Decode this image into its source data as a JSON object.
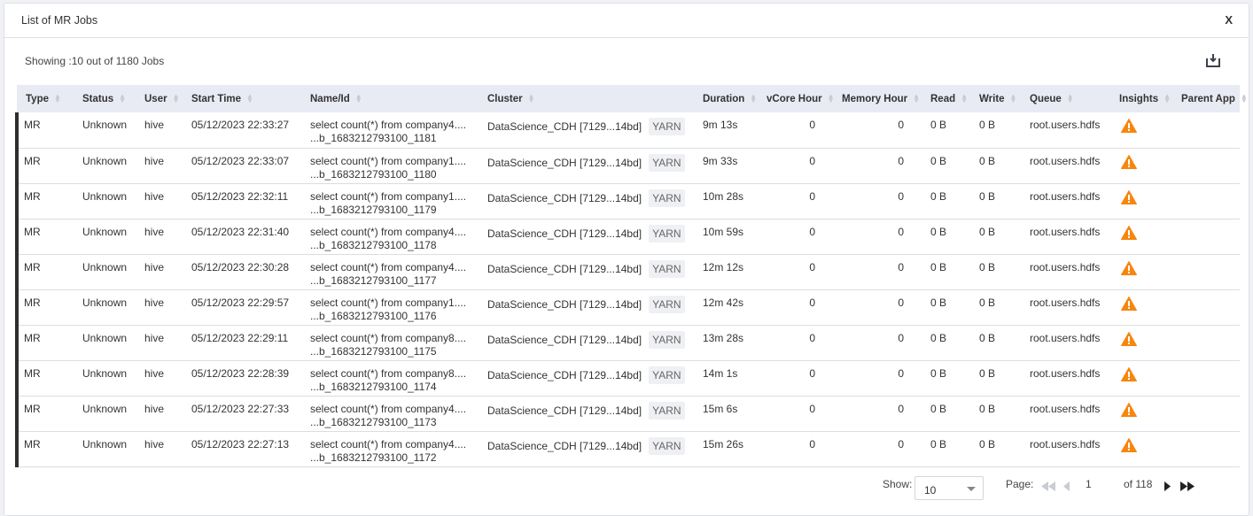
{
  "title": "List of MR Jobs",
  "close_label": "X",
  "showing": "Showing :10 out of 1180 Jobs",
  "columns": [
    "Type",
    "Status",
    "User",
    "Start Time",
    "Name/Id",
    "Cluster",
    "Duration",
    "vCore Hour",
    "Memory Hour",
    "Read",
    "Write",
    "Queue",
    "Insights",
    "Parent App"
  ],
  "rows": [
    {
      "type": "MR",
      "status": "Unknown",
      "user": "hive",
      "start": "05/12/2023 22:33:27",
      "name": "select count(*) from company4....",
      "id": "...b_1683212793100_1181",
      "cluster": "DataScience_CDH [7129...14bd]",
      "badge": "YARN",
      "duration": "9m 13s",
      "vcore": "0",
      "memory": "0",
      "read": "0 B",
      "write": "0 B",
      "queue": "root.users.hdfs",
      "insight": "warning-icon"
    },
    {
      "type": "MR",
      "status": "Unknown",
      "user": "hive",
      "start": "05/12/2023 22:33:07",
      "name": "select count(*) from company1....",
      "id": "...b_1683212793100_1180",
      "cluster": "DataScience_CDH [7129...14bd]",
      "badge": "YARN",
      "duration": "9m 33s",
      "vcore": "0",
      "memory": "0",
      "read": "0 B",
      "write": "0 B",
      "queue": "root.users.hdfs",
      "insight": "warning-icon"
    },
    {
      "type": "MR",
      "status": "Unknown",
      "user": "hive",
      "start": "05/12/2023 22:32:11",
      "name": "select count(*) from company1....",
      "id": "...b_1683212793100_1179",
      "cluster": "DataScience_CDH [7129...14bd]",
      "badge": "YARN",
      "duration": "10m 28s",
      "vcore": "0",
      "memory": "0",
      "read": "0 B",
      "write": "0 B",
      "queue": "root.users.hdfs",
      "insight": "warning-icon"
    },
    {
      "type": "MR",
      "status": "Unknown",
      "user": "hive",
      "start": "05/12/2023 22:31:40",
      "name": "select count(*) from company4....",
      "id": "...b_1683212793100_1178",
      "cluster": "DataScience_CDH [7129...14bd]",
      "badge": "YARN",
      "duration": "10m 59s",
      "vcore": "0",
      "memory": "0",
      "read": "0 B",
      "write": "0 B",
      "queue": "root.users.hdfs",
      "insight": "warning-icon"
    },
    {
      "type": "MR",
      "status": "Unknown",
      "user": "hive",
      "start": "05/12/2023 22:30:28",
      "name": "select count(*) from company4....",
      "id": "...b_1683212793100_1177",
      "cluster": "DataScience_CDH [7129...14bd]",
      "badge": "YARN",
      "duration": "12m 12s",
      "vcore": "0",
      "memory": "0",
      "read": "0 B",
      "write": "0 B",
      "queue": "root.users.hdfs",
      "insight": "warning-icon"
    },
    {
      "type": "MR",
      "status": "Unknown",
      "user": "hive",
      "start": "05/12/2023 22:29:57",
      "name": "select count(*) from company1....",
      "id": "...b_1683212793100_1176",
      "cluster": "DataScience_CDH [7129...14bd]",
      "badge": "YARN",
      "duration": "12m 42s",
      "vcore": "0",
      "memory": "0",
      "read": "0 B",
      "write": "0 B",
      "queue": "root.users.hdfs",
      "insight": "warning-icon"
    },
    {
      "type": "MR",
      "status": "Unknown",
      "user": "hive",
      "start": "05/12/2023 22:29:11",
      "name": "select count(*) from company8....",
      "id": "...b_1683212793100_1175",
      "cluster": "DataScience_CDH [7129...14bd]",
      "badge": "YARN",
      "duration": "13m 28s",
      "vcore": "0",
      "memory": "0",
      "read": "0 B",
      "write": "0 B",
      "queue": "root.users.hdfs",
      "insight": "warning-icon"
    },
    {
      "type": "MR",
      "status": "Unknown",
      "user": "hive",
      "start": "05/12/2023 22:28:39",
      "name": "select count(*) from company8....",
      "id": "...b_1683212793100_1174",
      "cluster": "DataScience_CDH [7129...14bd]",
      "badge": "YARN",
      "duration": "14m 1s",
      "vcore": "0",
      "memory": "0",
      "read": "0 B",
      "write": "0 B",
      "queue": "root.users.hdfs",
      "insight": "warning-icon"
    },
    {
      "type": "MR",
      "status": "Unknown",
      "user": "hive",
      "start": "05/12/2023 22:27:33",
      "name": "select count(*) from company4....",
      "id": "...b_1683212793100_1173",
      "cluster": "DataScience_CDH [7129...14bd]",
      "badge": "YARN",
      "duration": "15m 6s",
      "vcore": "0",
      "memory": "0",
      "read": "0 B",
      "write": "0 B",
      "queue": "root.users.hdfs",
      "insight": "warning-icon"
    },
    {
      "type": "MR",
      "status": "Unknown",
      "user": "hive",
      "start": "05/12/2023 22:27:13",
      "name": "select count(*) from company4....",
      "id": "...b_1683212793100_1172",
      "cluster": "DataScience_CDH [7129...14bd]",
      "badge": "YARN",
      "duration": "15m 26s",
      "vcore": "0",
      "memory": "0",
      "read": "0 B",
      "write": "0 B",
      "queue": "root.users.hdfs",
      "insight": "warning-icon"
    }
  ],
  "footer": {
    "show_label": "Show:",
    "page_size": "10",
    "page_label": "Page:",
    "page": "1",
    "of_pages": "of 118"
  },
  "colors": {
    "warning": "#f7860f",
    "row_marker": "#2e2e2e",
    "header_bg": "#e8ebf3"
  }
}
